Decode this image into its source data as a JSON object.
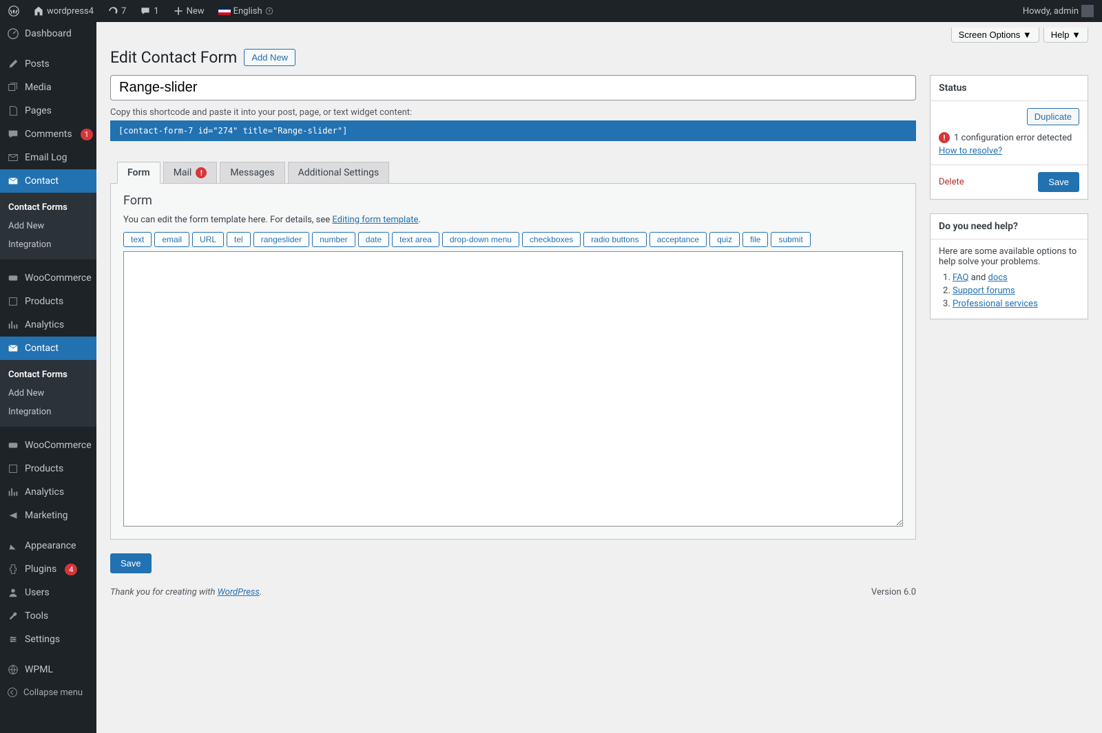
{
  "adminbar": {
    "site_name": "wordpress4",
    "updates": "7",
    "comments": "1",
    "new": "New",
    "language": "English",
    "howdy": "Howdy, admin"
  },
  "sidebar": {
    "items": [
      {
        "icon": "dashboard",
        "label": "Dashboard"
      },
      {
        "icon": "posts",
        "label": "Posts"
      },
      {
        "icon": "media",
        "label": "Media"
      },
      {
        "icon": "pages",
        "label": "Pages"
      },
      {
        "icon": "comments",
        "label": "Comments",
        "badge": "1"
      },
      {
        "icon": "email",
        "label": "Email Log"
      },
      {
        "icon": "contact",
        "label": "Contact",
        "current": true
      },
      {
        "icon": "woo",
        "label": "WooCommerce"
      },
      {
        "icon": "products",
        "label": "Products"
      },
      {
        "icon": "analytics",
        "label": "Analytics"
      },
      {
        "icon": "contact",
        "label": "Contact",
        "current": true
      },
      {
        "icon": "woo",
        "label": "WooCommerce"
      },
      {
        "icon": "products",
        "label": "Products"
      },
      {
        "icon": "analytics",
        "label": "Analytics"
      },
      {
        "icon": "marketing",
        "label": "Marketing"
      },
      {
        "icon": "appearance",
        "label": "Appearance"
      },
      {
        "icon": "plugins",
        "label": "Plugins",
        "badge": "4"
      },
      {
        "icon": "users",
        "label": "Users"
      },
      {
        "icon": "tools",
        "label": "Tools"
      },
      {
        "icon": "settings",
        "label": "Settings"
      },
      {
        "icon": "wpml",
        "label": "WPML"
      }
    ],
    "submenu1": [
      "Contact Forms",
      "Add New",
      "Integration"
    ],
    "submenu2": [
      "Contact Forms",
      "Add New",
      "Integration"
    ],
    "collapse": "Collapse menu"
  },
  "topbuttons": {
    "screen_options": "Screen Options",
    "help": "Help"
  },
  "heading": {
    "title": "Edit Contact Form",
    "add_new": "Add New"
  },
  "form_title": "Range-slider",
  "shortcode_label": "Copy this shortcode and paste it into your post, page, or text widget content:",
  "shortcode": "[contact-form-7 id=\"274\" title=\"Range-slider\"]",
  "tabs": [
    "Form",
    "Mail",
    "Messages",
    "Additional Settings"
  ],
  "form_panel": {
    "heading": "Form",
    "desc_pre": "You can edit the form template here. For details, see ",
    "desc_link": "Editing form template",
    "tags": [
      "text",
      "email",
      "URL",
      "tel",
      "rangeslider",
      "number",
      "date",
      "text area",
      "drop-down menu",
      "checkboxes",
      "radio buttons",
      "acceptance",
      "quiz",
      "file",
      "submit"
    ]
  },
  "save_btn": "Save",
  "status_box": {
    "title": "Status",
    "duplicate": "Duplicate",
    "error": "1 configuration error detected",
    "resolve": "How to resolve?",
    "delete": "Delete",
    "save": "Save"
  },
  "help_box": {
    "title": "Do you need help?",
    "desc": "Here are some available options to help solve your problems.",
    "faq": "FAQ",
    "and": " and ",
    "docs": "docs",
    "forums": "Support forums",
    "pro": "Professional services"
  },
  "footer": {
    "thankyou_pre": "Thank you for creating with ",
    "wp": "WordPress",
    "version": "Version 6.0"
  }
}
